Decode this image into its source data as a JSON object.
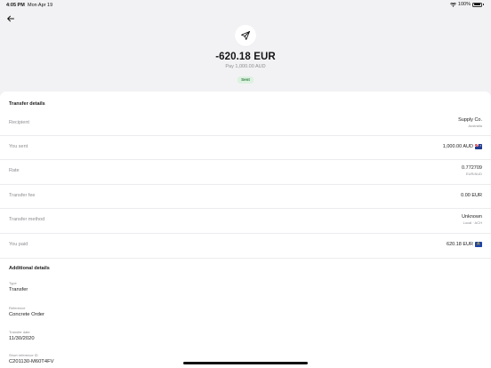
{
  "status_bar": {
    "time": "4:05 PM",
    "date": "Mon Apr 19",
    "battery": "100%"
  },
  "header": {
    "back_icon": "back-arrow-icon"
  },
  "hero": {
    "icon": "paper-plane-icon",
    "amount": "-620.18 EUR",
    "sub_amount": "Pay 1,000.00 AUD",
    "status": "Sent",
    "status_color": "#2d7b3c"
  },
  "transfer_details": {
    "title": "Transfer details",
    "rows": [
      {
        "label": "Recipient",
        "value": "Supply Co.",
        "sub": "Australia"
      },
      {
        "label": "You sent",
        "value": "1,000.00 AUD",
        "flag": "au-flag-icon"
      },
      {
        "label": "Rate",
        "value": "0.772709",
        "sub": "EUR/AUD"
      },
      {
        "label": "Transfer fee",
        "value": "0.00 EUR"
      },
      {
        "label": "Transfer method",
        "value": "Unknown",
        "sub": "Local · ACH"
      },
      {
        "label": "You paid",
        "value": "620.18 EUR",
        "flag": "eu-flag-icon"
      }
    ]
  },
  "additional_details": {
    "title": "Additional details",
    "items": [
      {
        "label": "Type",
        "value": "Transfer"
      },
      {
        "label": "Reference",
        "value": "Concrete Order"
      },
      {
        "label": "Transfer date",
        "value": "11/30/2020"
      },
      {
        "label": "Short reference ID",
        "value": "C201130-M60T4FV"
      }
    ]
  }
}
